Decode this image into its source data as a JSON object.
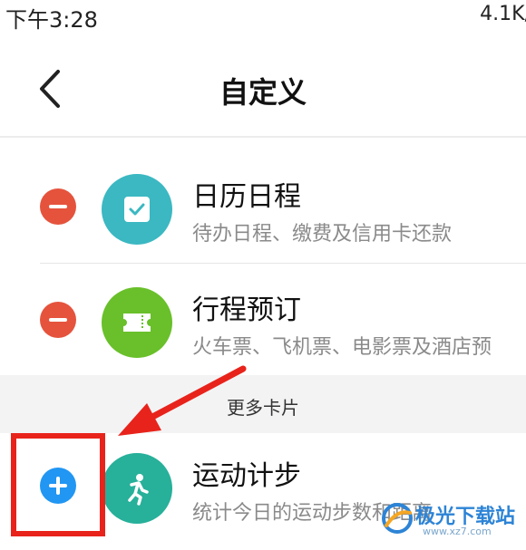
{
  "status_bar": {
    "time": "下午3:28",
    "speed": "4.1K/"
  },
  "header": {
    "title": "自定义",
    "back_icon": "chevron-left-icon"
  },
  "cards": [
    {
      "title": "日历日程",
      "description": "待办日程、缴费及信用卡还款",
      "action": "remove",
      "icon": "calendar-check-icon",
      "icon_color": "#3bb8c2"
    },
    {
      "title": "行程预订",
      "description": "火车票、飞机票、电影票及酒店预",
      "action": "remove",
      "icon": "ticket-icon",
      "icon_color": "#69c02a"
    }
  ],
  "more_section": {
    "label": "更多卡片",
    "cards": [
      {
        "title": "运动计步",
        "description": "统计今日的运动步数和距离",
        "action": "add",
        "icon": "running-person-icon",
        "icon_color": "#27b09a"
      }
    ]
  },
  "watermark": {
    "text": "极光下载站",
    "sub": "www.xz7.com"
  },
  "colors": {
    "remove": "#e5533d",
    "add": "#2196f3",
    "highlight": "#e8231b"
  }
}
